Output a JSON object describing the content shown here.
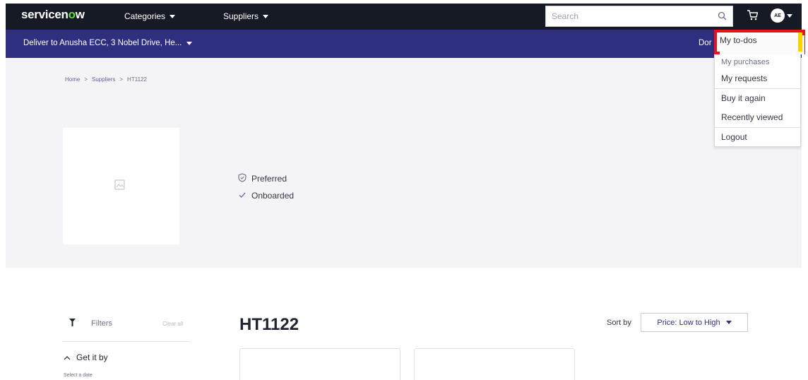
{
  "header": {
    "logo_text_a": "servicen",
    "logo_text_o": "o",
    "logo_text_b": "w",
    "nav": [
      {
        "label": "Categories"
      },
      {
        "label": "Suppliers"
      }
    ],
    "search_placeholder": "Search",
    "avatar_initials": "AE",
    "icons": [
      "search-icon",
      "cart-icon",
      "avatar"
    ]
  },
  "delivery": {
    "label": "Deliver to",
    "address": "Anusha ECC, 3 Nobel Drive, He...",
    "right_text_partial": "Dor"
  },
  "breadcrumb": [
    {
      "label": "Home"
    },
    {
      "label": "Suppliers"
    },
    {
      "label": "HT1122"
    }
  ],
  "supplier": {
    "badges": [
      {
        "label": "Preferred",
        "icon": "shield-check-icon"
      },
      {
        "label": "Onboarded",
        "icon": "check-icon"
      }
    ]
  },
  "filters": {
    "title": "Filters",
    "clear_all": "Clear all",
    "sections": [
      {
        "label": "Get it by",
        "sublabel": "Select a date"
      }
    ]
  },
  "main": {
    "title": "HT1122",
    "sort_label": "Sort by",
    "sort_value": "Price: Low to High"
  },
  "user_menu": {
    "items": [
      {
        "label": "My to-dos",
        "highlighted": true
      },
      {
        "label": "My purchases"
      },
      {
        "label": "My requests"
      },
      {
        "label": "Buy it again"
      },
      {
        "label": "Recently viewed"
      },
      {
        "label": "Logout"
      }
    ]
  },
  "colors": {
    "top_bar": "#161a25",
    "delivery_bar": "#2f2f7f",
    "logo_accent": "#62d84e",
    "highlight_border": "#e8141b",
    "highlight_accent": "#f7d400"
  }
}
